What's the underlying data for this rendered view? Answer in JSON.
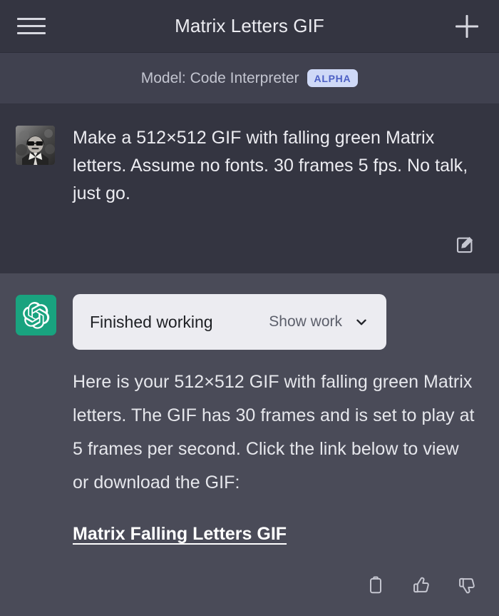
{
  "header": {
    "title": "Matrix Letters GIF",
    "menu_icon": "hamburger-menu-icon",
    "new_chat_icon": "plus-icon"
  },
  "model_bar": {
    "label": "Model: Code Interpreter",
    "badge": "ALPHA",
    "badge_bg": "#cfd9f7",
    "badge_color": "#4c5fc4"
  },
  "messages": {
    "user": {
      "avatar": "user-photo-avatar",
      "text": "Make a 512×512 GIF with falling green Matrix letters. Assume no fonts. 30 frames 5 fps. No talk, just go.",
      "edit_icon": "edit-pencil-square-icon"
    },
    "assistant": {
      "avatar": "openai-logo-icon",
      "avatar_bg": "#19a37f",
      "work_card": {
        "title": "Finished working",
        "action_label": "Show work",
        "chevron_icon": "chevron-down-icon",
        "bg": "#ececf1"
      },
      "text": "Here is your 512×512 GIF with falling green Matrix letters. The GIF has 30 frames and is set to play at 5 frames per second. Click the link below to view or download the GIF:",
      "link_text": "Matrix Falling Letters GIF",
      "actions": [
        {
          "name": "copy-icon",
          "label": "Copy"
        },
        {
          "name": "thumbs-up-icon",
          "label": "Good response"
        },
        {
          "name": "thumbs-down-icon",
          "label": "Bad response"
        }
      ]
    }
  },
  "colors": {
    "header_bg": "#343541",
    "model_bar_bg": "#40414f",
    "user_bg": "#343541",
    "assistant_bg": "#4a4b58",
    "text": "#ececf1"
  }
}
